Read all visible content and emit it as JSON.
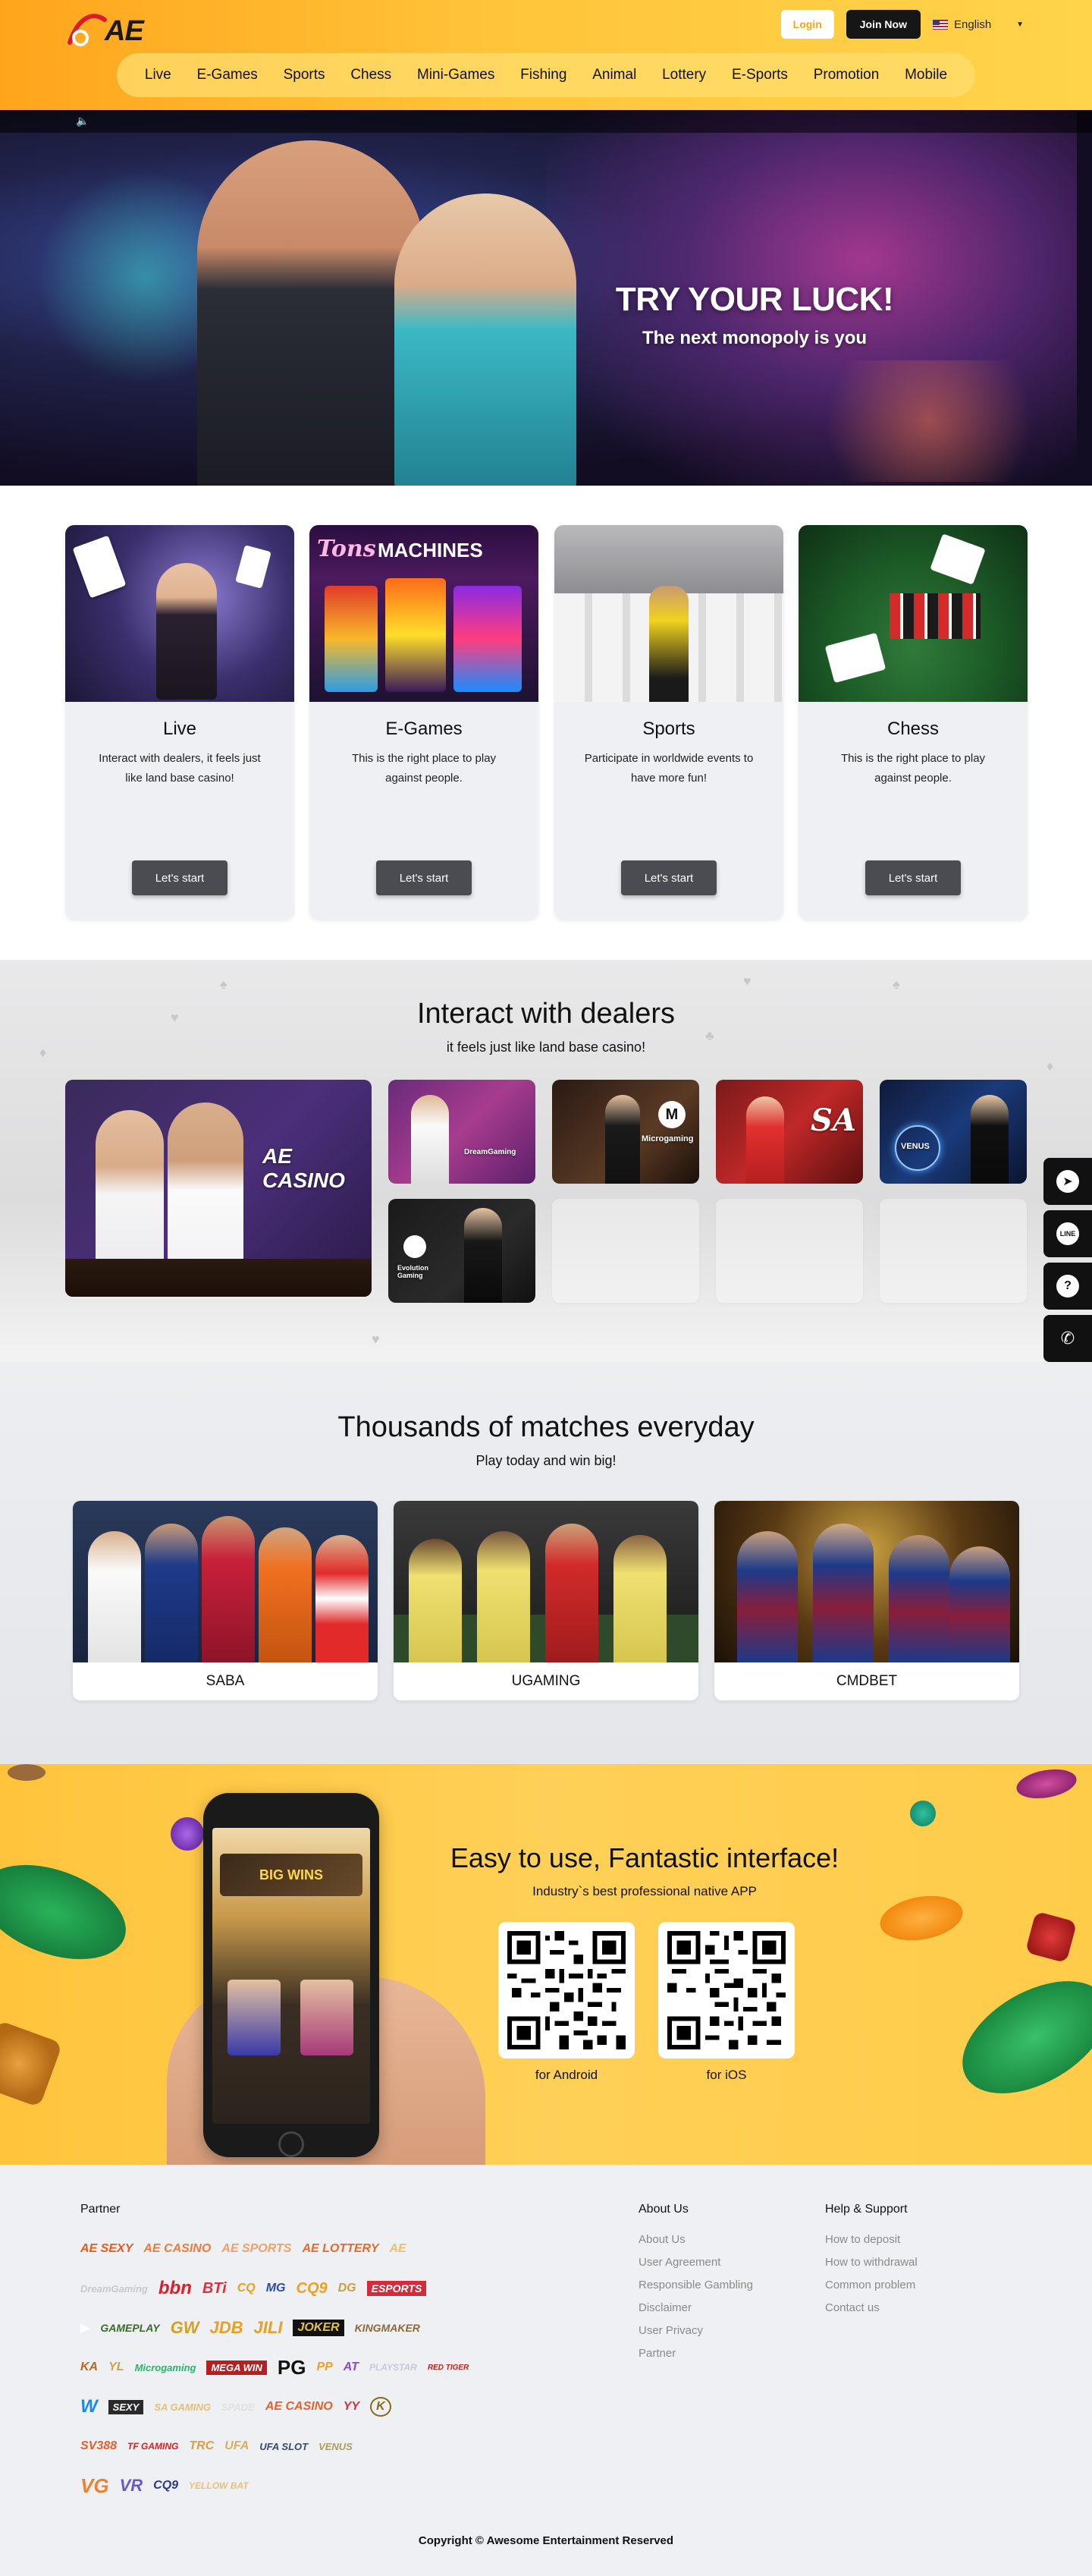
{
  "brand": {
    "name": "AE",
    "accent": "#ffb32a",
    "dark": "#161616"
  },
  "header": {
    "login_label": "Login",
    "join_label": "Join Now",
    "language": "English",
    "nav": [
      "Live",
      "E-Games",
      "Sports",
      "Chess",
      "Mini-Games",
      "Fishing",
      "Animal",
      "Lottery",
      "E-Sports",
      "Promotion",
      "Mobile"
    ]
  },
  "banner": {
    "title": "TRY YOUR LUCK!",
    "subtitle": "The next monopoly is you",
    "sound_icon": "speaker-icon"
  },
  "categories": [
    {
      "title": "Live",
      "desc": "Interact with dealers, it feels just like land base casino!",
      "button": "Let's start"
    },
    {
      "title": "E-Games",
      "desc": "This is the right place to play against people.",
      "button": "Let's start"
    },
    {
      "title": "Sports",
      "desc": "Participate in worldwide events to have more fun!",
      "button": "Let's start"
    },
    {
      "title": "Chess",
      "desc": "This is the right place to play against people.",
      "button": "Let's start"
    }
  ],
  "dealers": {
    "title": "Interact with dealers",
    "subtitle": "it feels just like land base casino!",
    "providers": [
      "AE CASINO",
      "DreamGaming",
      "Microgaming",
      "SA",
      "VENUS",
      "Evolution Gaming"
    ]
  },
  "sports": {
    "title": "Thousands of matches everyday",
    "subtitle": "Play today and win big!",
    "items": [
      "SABA",
      "UGAMING",
      "CMDBET"
    ]
  },
  "app": {
    "title": "Easy to use, Fantastic interface!",
    "subtitle": "Industry`s best professional native APP",
    "android_label": "for Android",
    "ios_label": "for iOS",
    "screen_banner": "BIG WINS"
  },
  "dock": [
    "telegram-icon",
    "line-icon",
    "help-icon",
    "phone-icon",
    "zalo-icon"
  ],
  "footer": {
    "partner_title": "Partner",
    "about_title": "About Us",
    "about_links": [
      "About Us",
      "User Agreement",
      "Responsible Gambling",
      "Disclaimer",
      "User Privacy",
      "Partner"
    ],
    "help_title": "Help & Support",
    "help_links": [
      "How to deposit",
      "How to withdrawal",
      "Common problem",
      "Contact us"
    ],
    "copyright": "Copyright © Awesome Entertainment Reserved"
  },
  "partners": [
    [
      "AE SEXY",
      "AE CASINO",
      "AE SPORTS",
      "AE LOTTERY",
      "AE"
    ],
    [
      "DreamGaming",
      "bbn",
      "BTi",
      "CQ",
      "MG",
      "CQ9",
      "DG",
      "ESPORTS"
    ],
    [
      "▶",
      "GAMEPLAY",
      "GW",
      "JDB",
      "JILI",
      "JOKER",
      "KINGMAKER"
    ],
    [
      "KA",
      "YL",
      "Microgaming",
      "MEGA WIN",
      "PG",
      "PP",
      "AT",
      "PLAYSTAR",
      "RED TIGER"
    ],
    [
      "W",
      "SEXY",
      "SA GAMING",
      "SPADE",
      "AE CASINO",
      "YY",
      "K"
    ],
    [
      "SV388",
      "TF GAMING",
      "TRC",
      "UFA",
      "UFA SLOT",
      "VENUS"
    ],
    [
      "VG",
      "VR",
      "CQ9",
      "YELLOW BAT"
    ]
  ]
}
